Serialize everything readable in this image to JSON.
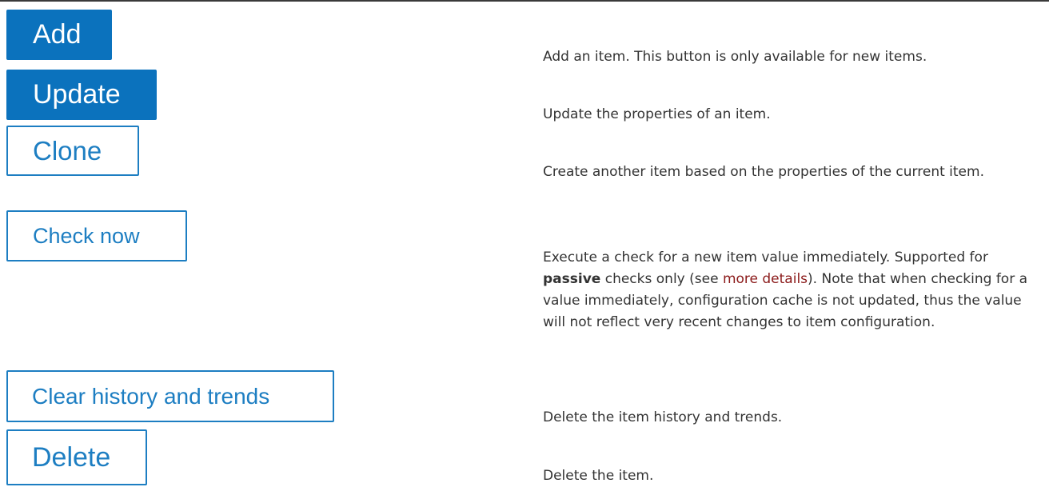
{
  "buttons": {
    "add": "Add",
    "update": "Update",
    "clone": "Clone",
    "check_now": "Check now",
    "clear_history": "Clear history and trends",
    "delete": "Delete"
  },
  "descriptions": {
    "add": "Add an item. This button is only available for new items.",
    "update": "Update the properties of an item.",
    "clone": "Create another item based on the properties of the current item.",
    "check_now": {
      "part1": "Execute a check for a new item value immediately. Supported for ",
      "bold": "passive",
      "part2": " checks only (see ",
      "link": "more details",
      "part3": "). Note that when checking for a value immediately, configuration cache is not updated, thus the value will not reflect very recent changes to item configuration."
    },
    "clear_history": "Delete the item history and trends.",
    "delete": "Delete the item."
  },
  "colors": {
    "primary_button": "#0b72bd",
    "secondary_border": "#1d7ec2",
    "link": "#8b1a1a"
  }
}
